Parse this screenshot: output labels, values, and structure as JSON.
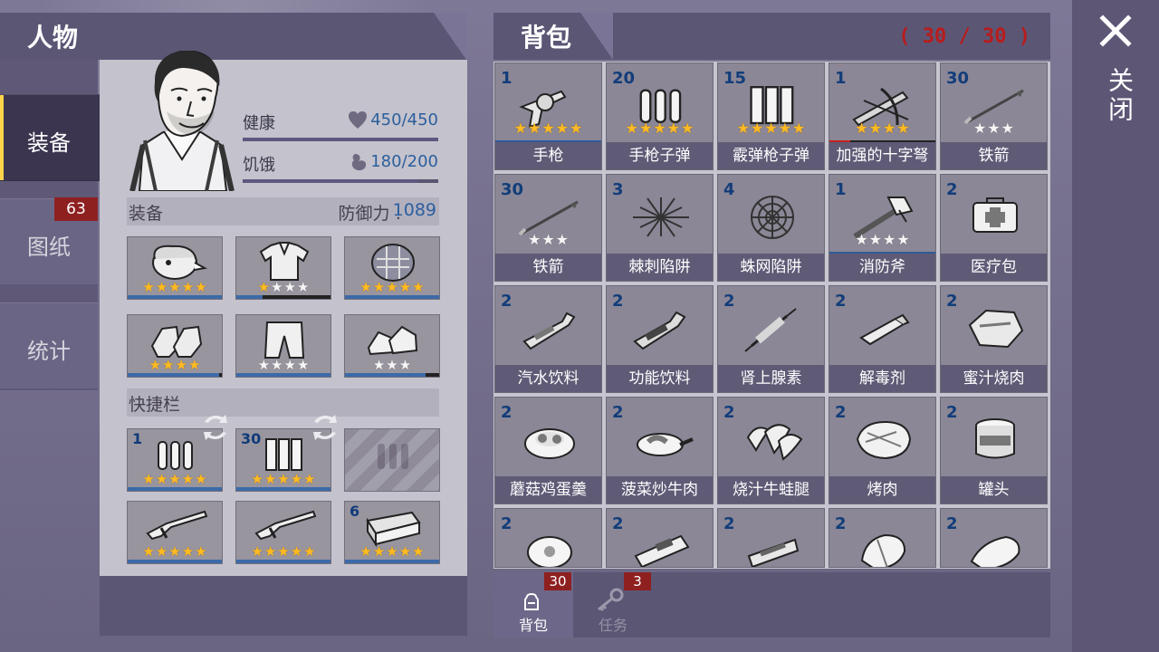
{
  "colors": {
    "accent_blue": "#2f5b98",
    "badge_red": "#8e2020",
    "panel_purple": "#5c5675",
    "cell_gray": "#8b8796"
  },
  "header": {
    "character_title": "人物",
    "backpack_title": "背包",
    "capacity": "( 30 / 30 )",
    "close_label": "关闭"
  },
  "left_tabs": [
    {
      "label": "装备",
      "active": true
    },
    {
      "label": "图纸",
      "badge": "63"
    },
    {
      "label": "统计"
    }
  ],
  "character": {
    "health_label": "健康",
    "health_value": "450/450",
    "health_ratio": 1.0,
    "hunger_label": "饥饿",
    "hunger_value": "180/200",
    "hunger_ratio": 0.9,
    "equipment_title": "装备",
    "defense_label": "防御力 :",
    "defense_value": "1089",
    "quickbar_title": "快捷栏"
  },
  "equipment_slots": [
    {
      "icon": "helmet-icon",
      "rating": 5,
      "stars_max": 5,
      "durability": 1.0
    },
    {
      "icon": "jacket-icon",
      "rating": 1,
      "stars_max": 4,
      "durability": 0.28
    },
    {
      "icon": "armor-shell-icon",
      "rating": 5,
      "stars_max": 5,
      "durability": 1.0
    },
    {
      "icon": "gloves-icon",
      "rating": 4,
      "stars_max": 4,
      "durability": 0.97
    },
    {
      "icon": "pants-icon",
      "rating": 0,
      "stars_max": 4,
      "durability": 1.0
    },
    {
      "icon": "shoes-icon",
      "rating": 0,
      "stars_max": 3,
      "durability": 0.86
    }
  ],
  "quickbar_slots": [
    {
      "count": "1",
      "icon": "pistol-ammo-icon",
      "rating": 5,
      "stars_max": 5
    },
    {
      "count": "30",
      "icon": "shotgun-shells-icon",
      "rating": 5,
      "stars_max": 5
    },
    {
      "empty": true,
      "icon": "empty-ammo-slot-icon"
    },
    {
      "icon": "shotgun-icon",
      "rating": 5,
      "stars_max": 5
    },
    {
      "icon": "shotgun-icon",
      "rating": 5,
      "stars_max": 5
    },
    {
      "count": "6",
      "icon": "brick-icon",
      "rating": 5,
      "stars_max": 5
    }
  ],
  "inventory_items": [
    {
      "count": "1",
      "name": "手枪",
      "icon": "revolver-icon",
      "rating": 5,
      "stars_max": 5,
      "durability": 1.0
    },
    {
      "count": "20",
      "name": "手枪子弹",
      "icon": "pistol-ammo-icon",
      "rating": 5,
      "stars_max": 5
    },
    {
      "count": "15",
      "name": "霰弹枪子弹",
      "icon": "shotgun-shells-icon",
      "rating": 5,
      "stars_max": 5
    },
    {
      "count": "1",
      "name": "加强的十字弩",
      "icon": "crossbow-icon",
      "rating": 4,
      "stars_max": 4,
      "durability": 0.2,
      "durability_color": "#c52020"
    },
    {
      "count": "30",
      "name": "铁箭",
      "icon": "arrow-icon",
      "rating": 0,
      "stars_max": 3
    },
    {
      "count": "30",
      "name": "铁箭",
      "icon": "arrow-icon",
      "rating": 0,
      "stars_max": 3
    },
    {
      "count": "3",
      "name": "棘刺陷阱",
      "icon": "spike-trap-icon"
    },
    {
      "count": "4",
      "name": "蛛网陷阱",
      "icon": "spiderweb-trap-icon"
    },
    {
      "count": "1",
      "name": "消防斧",
      "icon": "fire-axe-icon",
      "rating": 0,
      "stars_max": 4,
      "durability": 1.0
    },
    {
      "count": "2",
      "name": "医疗包",
      "icon": "medkit-icon"
    },
    {
      "count": "2",
      "name": "汽水饮料",
      "icon": "soda-icon"
    },
    {
      "count": "2",
      "name": "功能饮料",
      "icon": "energy-drink-icon"
    },
    {
      "count": "2",
      "name": "肾上腺素",
      "icon": "adrenaline-icon"
    },
    {
      "count": "2",
      "name": "解毒剂",
      "icon": "antidote-icon"
    },
    {
      "count": "2",
      "name": "蜜汁烧肉",
      "icon": "glazed-meat-icon"
    },
    {
      "count": "2",
      "name": "蘑菇鸡蛋羹",
      "icon": "mushroom-egg-custard-icon"
    },
    {
      "count": "2",
      "name": "菠菜炒牛肉",
      "icon": "spinach-beef-icon"
    },
    {
      "count": "2",
      "name": "烧汁牛蛙腿",
      "icon": "bullfrog-legs-icon"
    },
    {
      "count": "2",
      "name": "烤肉",
      "icon": "roast-meat-icon"
    },
    {
      "count": "2",
      "name": "罐头",
      "icon": "can-icon"
    },
    {
      "count": "2",
      "icon": "egg-icon"
    },
    {
      "count": "2",
      "icon": "energy-bar-icon"
    },
    {
      "count": "2",
      "icon": "snack-bar-icon"
    },
    {
      "count": "2",
      "icon": "bandage-icon"
    },
    {
      "count": "2",
      "icon": "cloth-icon"
    }
  ],
  "bottom_tabs": [
    {
      "label": "背包",
      "badge": "30",
      "icon": "backpack-icon",
      "active": true
    },
    {
      "label": "任务",
      "badge": "3",
      "icon": "key-icon"
    }
  ]
}
